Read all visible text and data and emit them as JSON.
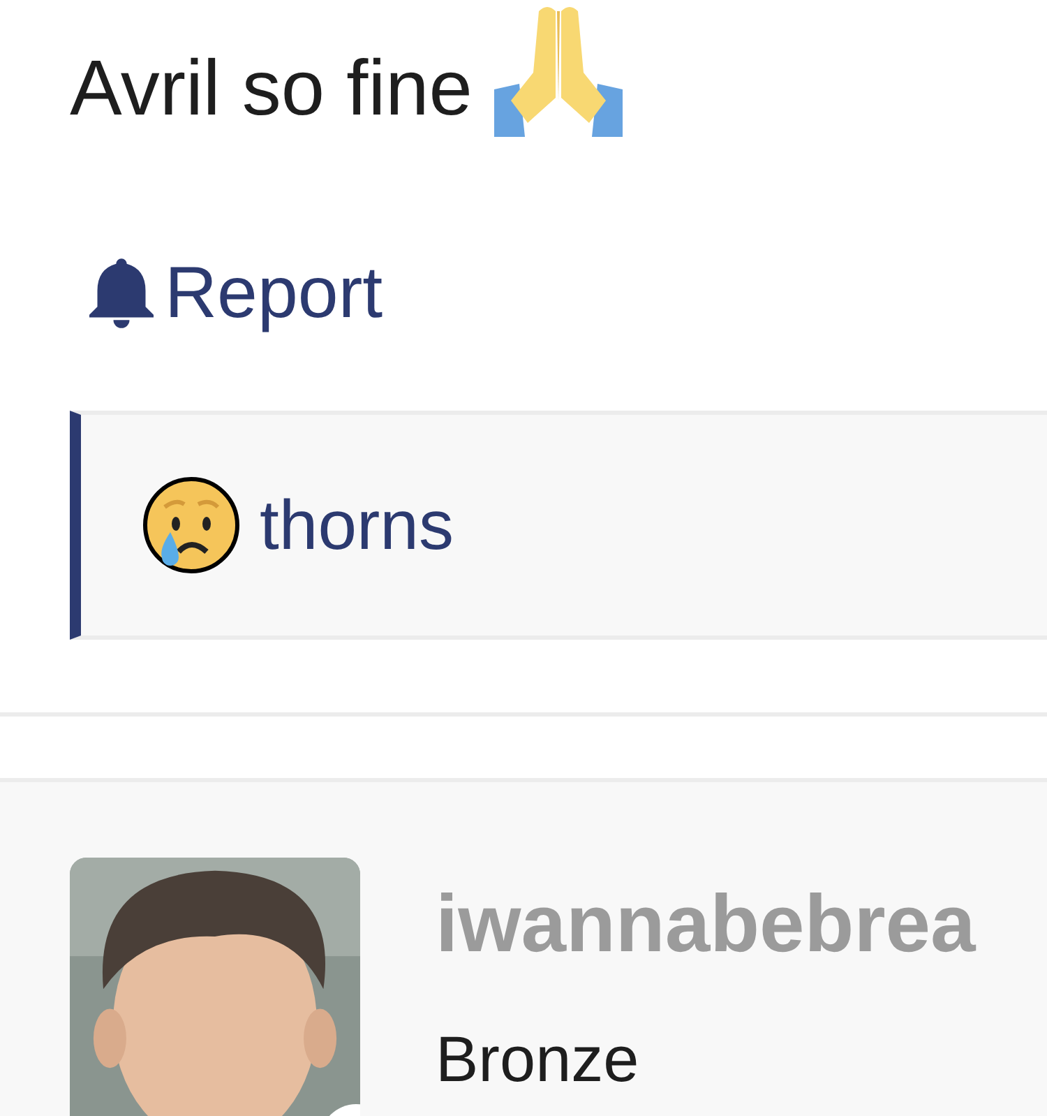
{
  "post": {
    "text": "Avril so fine",
    "report": "Report"
  },
  "quote": {
    "author": "thorns"
  },
  "next_post": {
    "username": "iwannabebrea",
    "rank": "Bronze"
  }
}
